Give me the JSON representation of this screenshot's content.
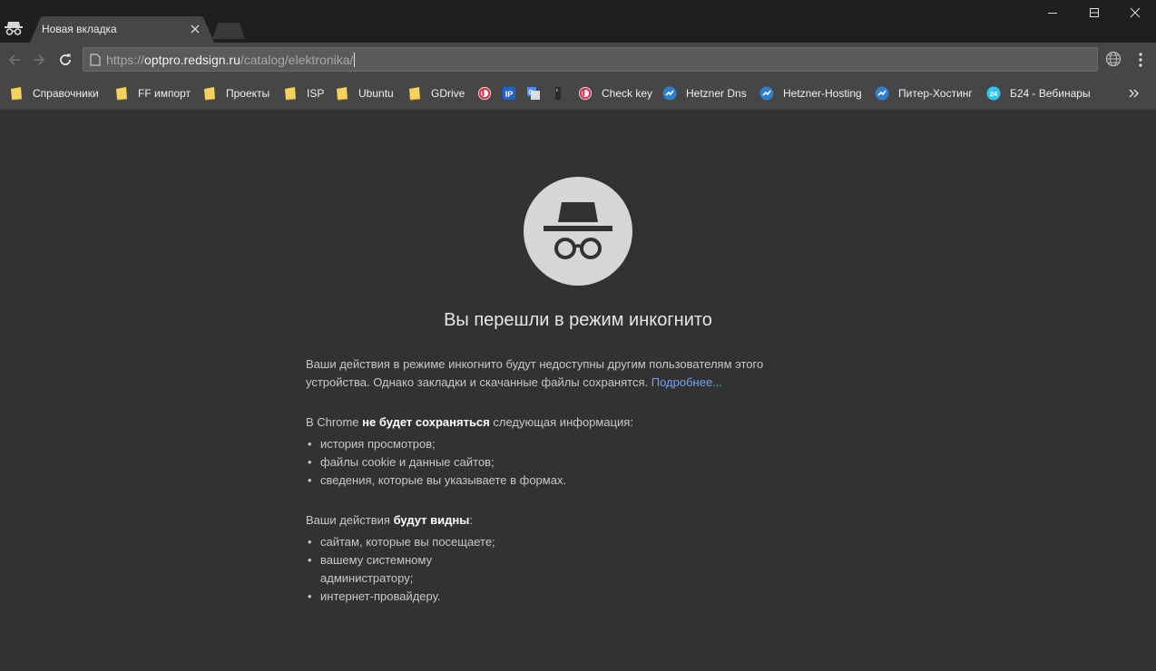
{
  "tab": {
    "title": "Новая вкладка"
  },
  "window": {
    "controls": [
      "minimize-icon",
      "maximize-icon",
      "close-icon"
    ]
  },
  "toolbar": {
    "url_scheme": "https://",
    "url_host": "optpro.redsign.ru",
    "url_path": "/catalog/elektronika/"
  },
  "bookmarks": [
    {
      "label": "Справочники",
      "icon": "folder-icon"
    },
    {
      "label": "FF импорт",
      "icon": "folder-icon"
    },
    {
      "label": "Проекты",
      "icon": "folder-icon"
    },
    {
      "label": "ISP",
      "icon": "folder-icon"
    },
    {
      "label": "Ubuntu",
      "icon": "folder-icon"
    },
    {
      "label": "GDrive",
      "icon": "folder-icon"
    },
    {
      "label": "",
      "icon": "b-logo-icon"
    },
    {
      "label": "",
      "icon": "ip-icon"
    },
    {
      "label": "",
      "icon": "translate-icon"
    },
    {
      "label": "",
      "icon": "dark-site-icon"
    },
    {
      "label": "Check key",
      "icon": "b-logo-icon"
    },
    {
      "label": "Hetzner Dns",
      "icon": "hetzner-icon"
    },
    {
      "label": "Hetzner-Hosting",
      "icon": "hetzner-icon"
    },
    {
      "label": "Питер-Хостинг",
      "icon": "hetzner-icon"
    },
    {
      "label": "Б24 - Вебинары",
      "icon": "b24-icon"
    }
  ],
  "page": {
    "heading": "Вы перешли в режим инкогнито",
    "intro": "Ваши действия в режиме инкогнито будут недоступны другим пользователям этого устройства. Однако закладки и скачанные файлы сохранятся.",
    "learn_more": "Подробнее...",
    "not_saved_prefix": "В Chrome ",
    "not_saved_bold": "не будет сохраняться",
    "not_saved_suffix": " следующая информация:",
    "not_saved_items": [
      "история просмотров;",
      "файлы cookie и данные сайтов;",
      "сведения, которые вы указываете в формах."
    ],
    "visible_prefix": "Ваши действия ",
    "visible_bold": "будут видны",
    "visible_suffix": ":",
    "visible_items": [
      "сайтам, которые вы посещаете;",
      "вашему системному администратору;",
      "интернет-провайдеру."
    ]
  },
  "colors": {
    "frame": "#1f1f1f",
    "toolbar": "#464646",
    "page_bg": "#323232",
    "link": "#6ea5f5",
    "folder": "#f5d35c"
  }
}
